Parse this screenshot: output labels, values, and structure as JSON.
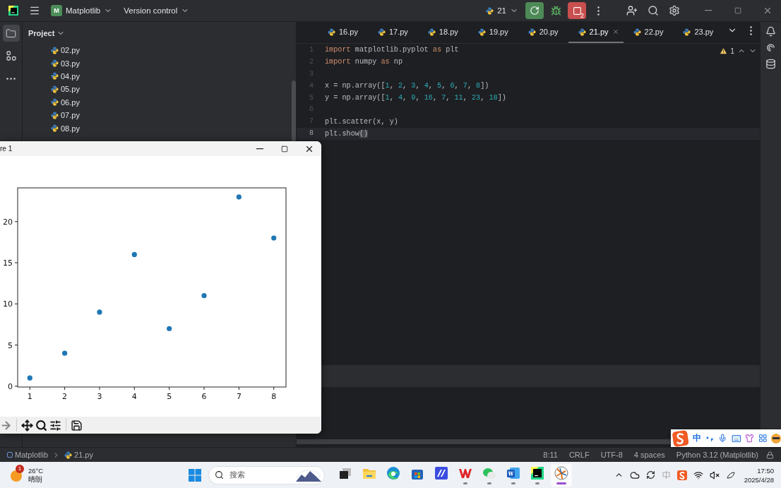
{
  "title_bar": {
    "project_badge": "M",
    "project": "Matplotlib",
    "vcs": "Version control",
    "run_count": "21",
    "running_count": "2"
  },
  "tool_strip": [
    {
      "kind": "folder",
      "selected": true
    },
    {
      "kind": "structure",
      "selected": false
    },
    {
      "kind": "more",
      "selected": false
    }
  ],
  "project_panel": {
    "title": "Project",
    "files": [
      "02.py",
      "03.py",
      "04.py",
      "05.py",
      "06.py",
      "07.py",
      "08.py"
    ]
  },
  "tabs": [
    {
      "label": "16.py",
      "selected": false
    },
    {
      "label": "17.py",
      "selected": false
    },
    {
      "label": "18.py",
      "selected": false
    },
    {
      "label": "19.py",
      "selected": false
    },
    {
      "label": "20.py",
      "selected": false
    },
    {
      "label": "21.py",
      "selected": true
    },
    {
      "label": "22.py",
      "selected": false
    },
    {
      "label": "23.py",
      "selected": false
    }
  ],
  "editor": {
    "warnings": "1",
    "lines": [
      {
        "number": "1",
        "current": false,
        "tokens": [
          {
            "text": "import",
            "kind": "keyword"
          },
          {
            "text": " matplotlib.pyplot ",
            "kind": "plain"
          },
          {
            "text": "as",
            "kind": "keyword"
          },
          {
            "text": " plt",
            "kind": "plain"
          }
        ]
      },
      {
        "number": "2",
        "current": false,
        "tokens": [
          {
            "text": "import",
            "kind": "keyword"
          },
          {
            "text": " numpy ",
            "kind": "plain"
          },
          {
            "text": "as",
            "kind": "keyword"
          },
          {
            "text": " np",
            "kind": "plain"
          }
        ]
      },
      {
        "number": "3",
        "current": false
      },
      {
        "number": "4",
        "current": false,
        "tokens": [
          {
            "text": "x = np.array([",
            "kind": "plain"
          },
          {
            "text": "1",
            "kind": "number"
          },
          {
            "text": ", ",
            "kind": "plain"
          },
          {
            "text": "2",
            "kind": "number"
          },
          {
            "text": ", ",
            "kind": "plain"
          },
          {
            "text": "3",
            "kind": "number"
          },
          {
            "text": ", ",
            "kind": "plain"
          },
          {
            "text": "4",
            "kind": "number"
          },
          {
            "text": ", ",
            "kind": "plain"
          },
          {
            "text": "5",
            "kind": "number"
          },
          {
            "text": ", ",
            "kind": "plain"
          },
          {
            "text": "6",
            "kind": "number"
          },
          {
            "text": ", ",
            "kind": "plain"
          },
          {
            "text": "7",
            "kind": "number"
          },
          {
            "text": ", ",
            "kind": "plain"
          },
          {
            "text": "8",
            "kind": "number"
          },
          {
            "text": "])",
            "kind": "plain"
          }
        ]
      },
      {
        "number": "5",
        "current": false,
        "tokens": [
          {
            "text": "y = np.array([",
            "kind": "plain"
          },
          {
            "text": "1",
            "kind": "number"
          },
          {
            "text": ", ",
            "kind": "plain"
          },
          {
            "text": "4",
            "kind": "number"
          },
          {
            "text": ", ",
            "kind": "plain"
          },
          {
            "text": "9",
            "kind": "number"
          },
          {
            "text": ", ",
            "kind": "plain"
          },
          {
            "text": "16",
            "kind": "number"
          },
          {
            "text": ", ",
            "kind": "plain"
          },
          {
            "text": "7",
            "kind": "number"
          },
          {
            "text": ", ",
            "kind": "plain"
          },
          {
            "text": "11",
            "kind": "number"
          },
          {
            "text": ", ",
            "kind": "plain"
          },
          {
            "text": "23",
            "kind": "number"
          },
          {
            "text": ", ",
            "kind": "plain"
          },
          {
            "text": "18",
            "kind": "number"
          },
          {
            "text": "])",
            "kind": "plain"
          }
        ]
      },
      {
        "number": "6",
        "current": false
      },
      {
        "number": "7",
        "current": false,
        "tokens": [
          {
            "text": "plt.scatter(x, y)",
            "kind": "plain"
          }
        ]
      },
      {
        "number": "8",
        "current": true,
        "tokens": [
          {
            "text": "plt.show",
            "kind": "plain"
          },
          {
            "text": "()",
            "kind": "matched"
          }
        ]
      }
    ]
  },
  "figure": {
    "title": "re 1",
    "chart_data": {
      "type": "scatter",
      "x": [
        1,
        2,
        3,
        4,
        5,
        6,
        7,
        8
      ],
      "series": [
        {
          "color": "#1f77b4",
          "values": [
            1,
            4,
            9,
            16,
            7,
            11,
            23,
            18
          ]
        }
      ],
      "xlim": [
        0.65,
        8.35
      ],
      "ylim": [
        -0.1,
        24.1
      ],
      "xticks": [
        1,
        2,
        3,
        4,
        5,
        6,
        7,
        8
      ],
      "yticks": [
        0,
        5,
        10,
        15,
        20
      ]
    }
  },
  "status_bar": {
    "breadcrumb": [
      "Matplotlib",
      "21.py"
    ],
    "items": [
      "8:11",
      "CRLF",
      "UTF-8",
      "4 spaces",
      "Python 3.12 (Matplotlib)"
    ]
  },
  "ime_bar": {
    "mode": "中"
  },
  "taskbar": {
    "weather": {
      "badge": "1",
      "temperature": "26°C",
      "condition": "晴朗"
    },
    "search": {
      "placeholder": "搜索"
    },
    "apps": [
      {
        "kind": "taskview",
        "running": false,
        "active": false
      },
      {
        "kind": "explorer",
        "running": false,
        "active": false
      },
      {
        "kind": "edge",
        "running": false,
        "active": false
      },
      {
        "kind": "store",
        "running": false,
        "active": false
      },
      {
        "kind": "studio",
        "running": false,
        "active": false
      },
      {
        "kind": "wps",
        "running": true,
        "active": false
      },
      {
        "kind": "wechat",
        "running": true,
        "active": false
      },
      {
        "kind": "word",
        "running": true,
        "active": false
      },
      {
        "kind": "pycharm",
        "running": true,
        "active": false
      },
      {
        "kind": "figure",
        "running": true,
        "active": true
      }
    ],
    "clock": {
      "time": "17:50",
      "date": "2025/4/28"
    }
  }
}
